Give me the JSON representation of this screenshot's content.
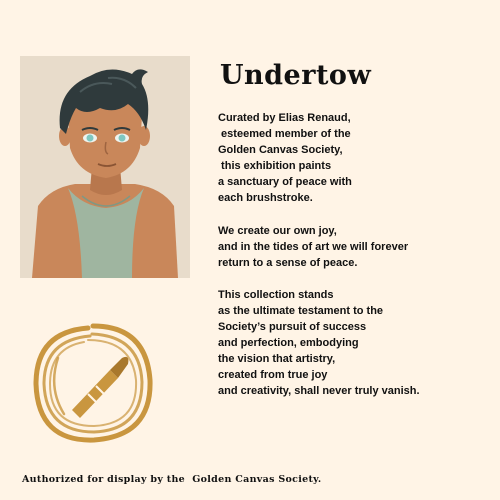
{
  "title": "Undertow",
  "paragraphs": [
    [
      "Curated by Elias Renaud,",
      " esteemed member of the",
      "Golden Canvas Society,",
      " this exhibition paints",
      "a sanctuary of peace with",
      "each brushstroke."
    ],
    [
      "We create our own joy,",
      "and in the tides of art we will forever",
      "return to a sense of peace."
    ],
    [
      "This collection stands",
      "as the ultimate testament to the",
      "Society’s pursuit of success",
      "and perfection, embodying",
      "the vision that artistry,",
      "created from true joy",
      "and creativity, shall never truly vanish."
    ]
  ],
  "footer": "Authorized for display by the  Golden Canvas Society.",
  "colors": {
    "background": "#fff4e6",
    "portrait_bg": "#e8dccb",
    "skin": "#c9875a",
    "hair": "#2f3a3c",
    "shirt": "#9fb5a0",
    "emblem_gold": "#c9963f"
  },
  "icons": [
    "portrait-illustration",
    "golden-brush-emblem"
  ]
}
